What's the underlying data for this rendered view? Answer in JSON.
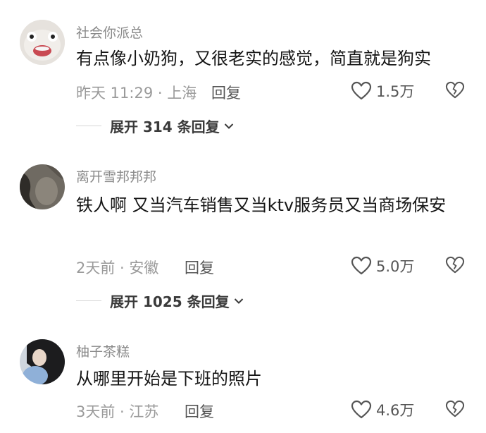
{
  "comments": [
    {
      "username": "社会你派总",
      "text": "有点像小奶狗，又很老实的感觉，简直就是狗实",
      "meta": "昨天 11:29 · 上海",
      "reply_label": "回复",
      "likes": "1.5万",
      "expand_label": "展开 314 条回复"
    },
    {
      "username": "离开雪邦邦邦",
      "text": "铁人啊 又当汽车销售又当ktv服务员又当商场保安",
      "meta": "2天前 · 安徽",
      "reply_label": "回复",
      "likes": "5.0万",
      "expand_label": "展开 1025 条回复"
    },
    {
      "username": "柚子茶糕",
      "text": "从哪里开始是下班的照片",
      "meta": "3天前 · 江苏",
      "reply_label": "回复",
      "likes": "4.6万"
    }
  ],
  "icons": {
    "like": "heart-outline-icon",
    "dislike": "broken-heart-icon",
    "expand": "chevron-down-icon"
  },
  "colors": {
    "text": "#161616",
    "muted": "#9a9a9a",
    "username": "#8a8a8a"
  }
}
